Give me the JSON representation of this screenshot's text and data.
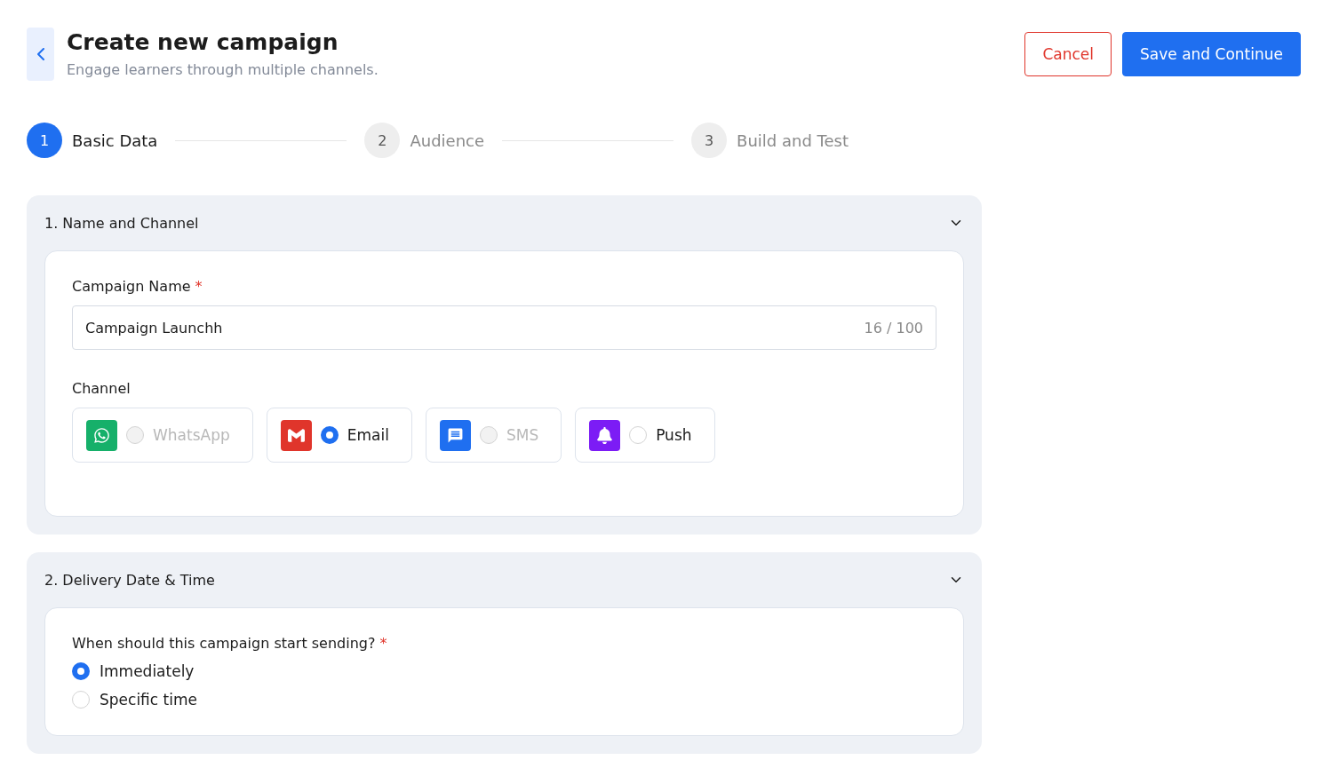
{
  "header": {
    "title": "Create new campaign",
    "subtitle": "Engage learners through multiple channels.",
    "cancel": "Cancel",
    "save": "Save and Continue"
  },
  "steps": [
    {
      "number": "1",
      "label": "Basic Data",
      "selected": true
    },
    {
      "number": "2",
      "label": "Audience",
      "selected": false
    },
    {
      "number": "3",
      "label": "Build and Test",
      "selected": false
    }
  ],
  "sections": [
    {
      "kind": "name_channel",
      "title": "1. Name and Channel",
      "expanded": true,
      "name_label": "Campaign Name",
      "required_mark": "*",
      "name_value": "Campaign Launchh",
      "counter": "16 / 100",
      "channel_label": "Channel",
      "channels": [
        {
          "kind": "whatsapp",
          "label": "WhatsApp",
          "color": "#16b06a",
          "disabled": true,
          "selected": false
        },
        {
          "kind": "email",
          "label": "Email",
          "color": "#e0352b",
          "disabled": false,
          "selected": true
        },
        {
          "kind": "sms",
          "label": "SMS",
          "color": "#1f6ff0",
          "disabled": true,
          "selected": false
        },
        {
          "kind": "push",
          "label": "Push",
          "color": "#7c1cf5",
          "disabled": false,
          "selected": false
        }
      ]
    },
    {
      "kind": "delivery",
      "title": "2. Delivery Date & Time",
      "expanded": true,
      "question": "When should this campaign start sending?",
      "required_mark": "*",
      "options": [
        {
          "label": "Immediately",
          "selected": true
        },
        {
          "label": "Specific time",
          "selected": false
        }
      ]
    }
  ]
}
